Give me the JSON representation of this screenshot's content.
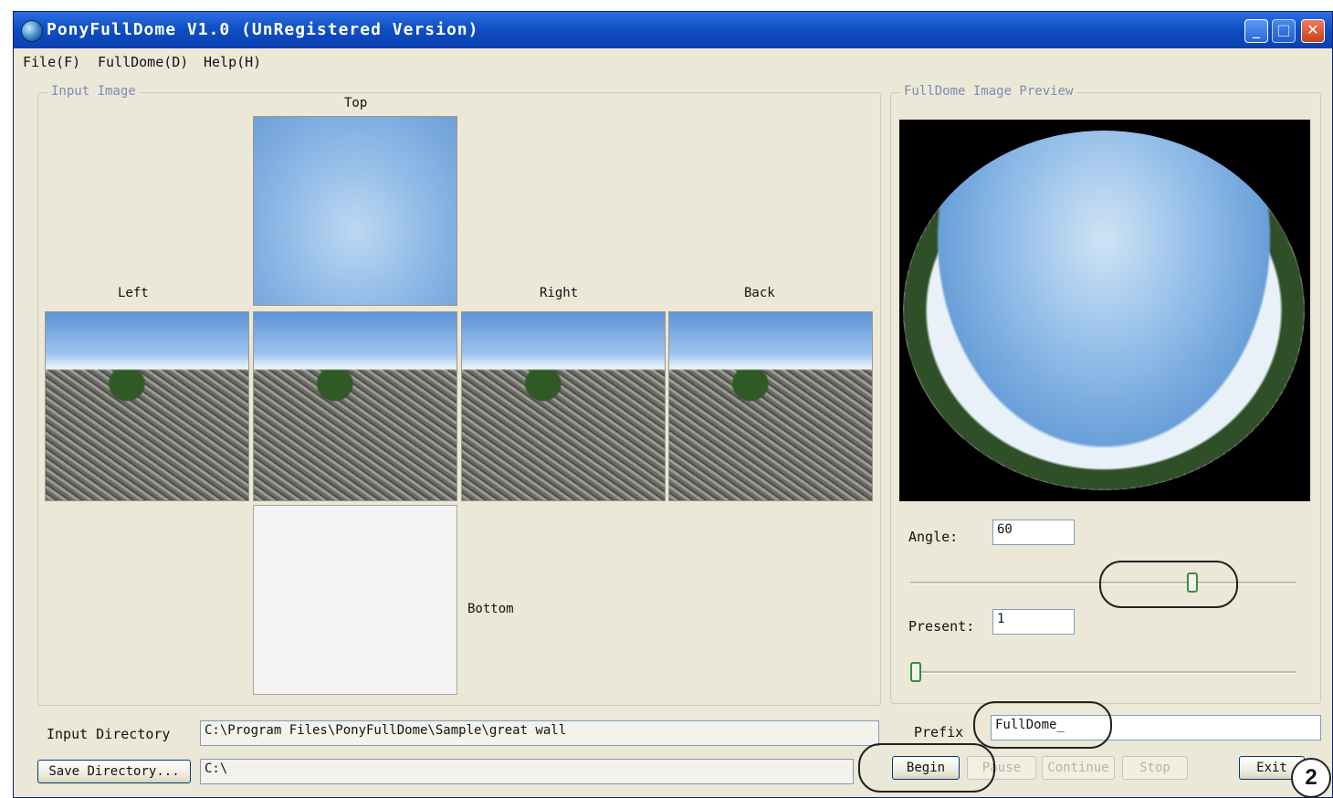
{
  "window": {
    "title": "PonyFullDome V1.0 (UnRegistered Version)",
    "controls": {
      "minimize": "_",
      "maximize": "□",
      "close": "✕"
    }
  },
  "menu": [
    "File(F)",
    "FullDome(D)",
    "Help(H)"
  ],
  "input_image": {
    "group_label": "Input Image",
    "faces": {
      "top": "Top",
      "left": "Left",
      "right": "Right",
      "back": "Back",
      "bottom": "Bottom"
    }
  },
  "preview": {
    "group_label": "FullDome Image Preview"
  },
  "controls": {
    "angle_label": "Angle:",
    "angle_value": "60",
    "angle_slider_fraction": 0.74,
    "present_label": "Present:",
    "present_value": "1",
    "present_slider_fraction": 0.0
  },
  "io": {
    "input_dir_label": "Input Directory",
    "input_dir_value": "C:\\Program Files\\PonyFullDome\\Sample\\great wall",
    "save_dir_button": "Save Directory...",
    "save_dir_value": "C:\\",
    "prefix_label": "Prefix",
    "prefix_value": "FullDome_"
  },
  "actions": {
    "begin": "Begin",
    "pause": "Pause",
    "continue": "Continue",
    "stop": "Stop",
    "exit": "Exit"
  },
  "annotation": {
    "badge": "2"
  },
  "colors": {
    "titlebar": "#0f4fc4",
    "window_bg": "#ebe8d8",
    "slider_thumb": "#3d8a3d"
  }
}
